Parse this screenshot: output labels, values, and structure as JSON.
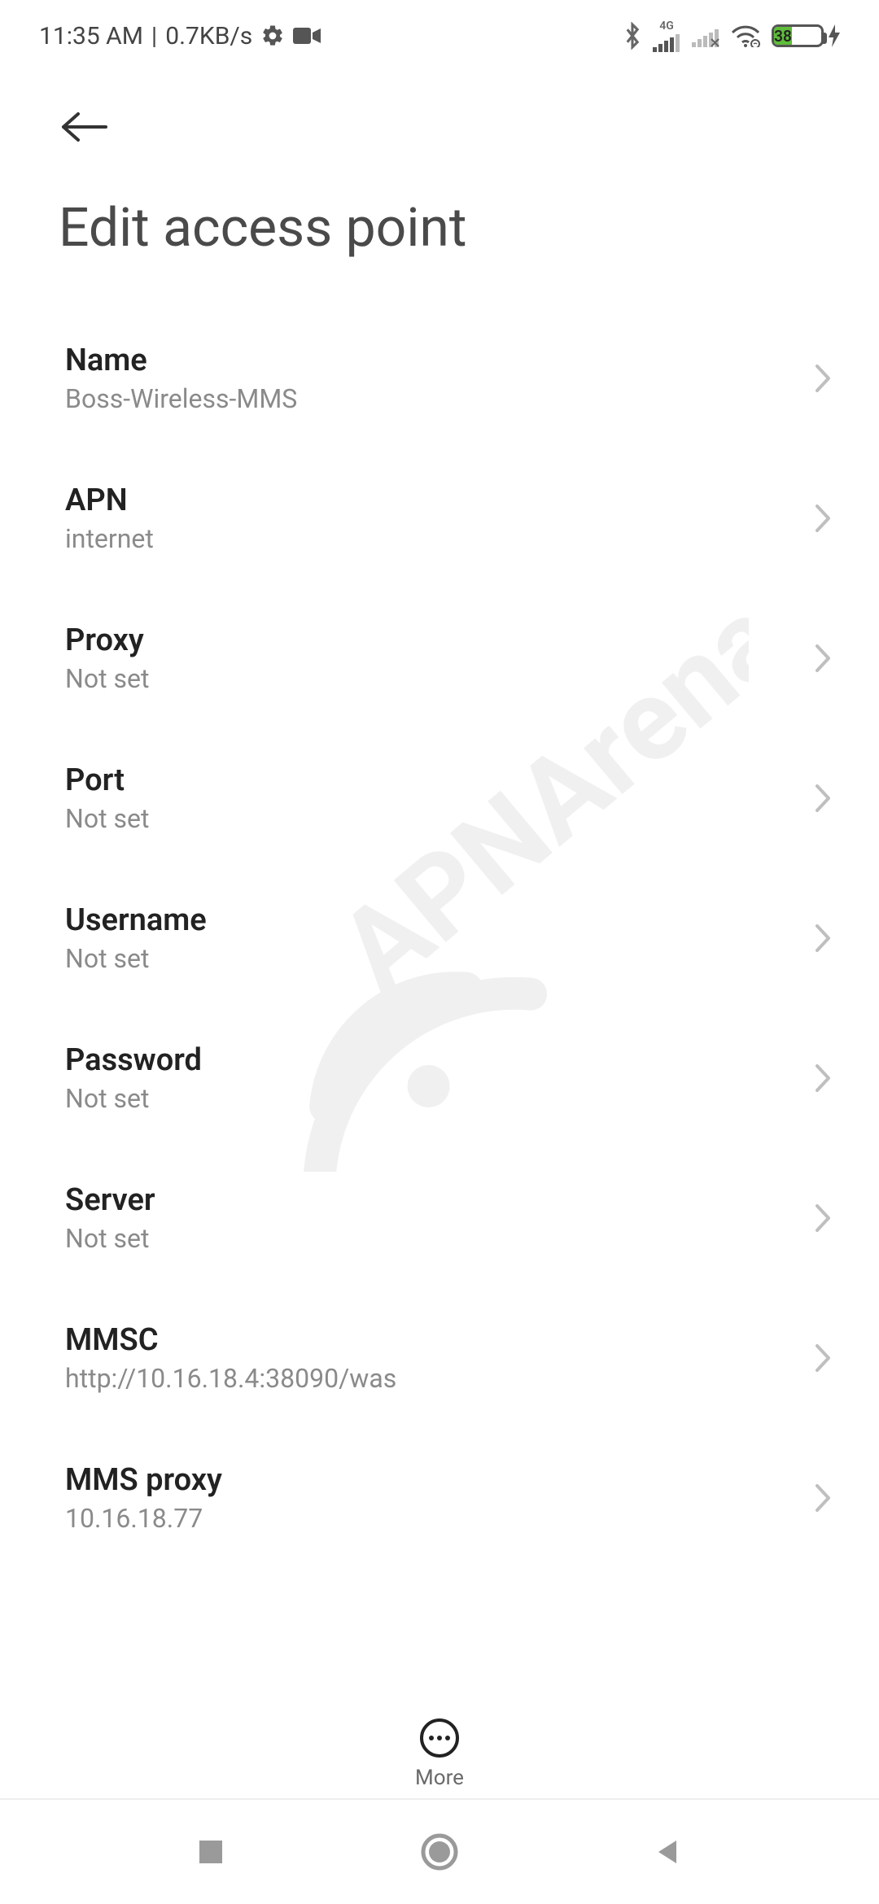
{
  "status_bar": {
    "time": "11:35 AM",
    "net_speed": "0.7KB/s",
    "signal_label": "4G",
    "battery_percent": "38"
  },
  "header": {
    "title": "Edit access point"
  },
  "rows": [
    {
      "label": "Name",
      "value": "Boss-Wireless-MMS"
    },
    {
      "label": "APN",
      "value": "internet"
    },
    {
      "label": "Proxy",
      "value": "Not set"
    },
    {
      "label": "Port",
      "value": "Not set"
    },
    {
      "label": "Username",
      "value": "Not set"
    },
    {
      "label": "Password",
      "value": "Not set"
    },
    {
      "label": "Server",
      "value": "Not set"
    },
    {
      "label": "MMSC",
      "value": "http://10.16.18.4:38090/was"
    },
    {
      "label": "MMS proxy",
      "value": "10.16.18.77"
    }
  ],
  "bottom": {
    "more_label": "More"
  },
  "watermark_text": "APNArena"
}
